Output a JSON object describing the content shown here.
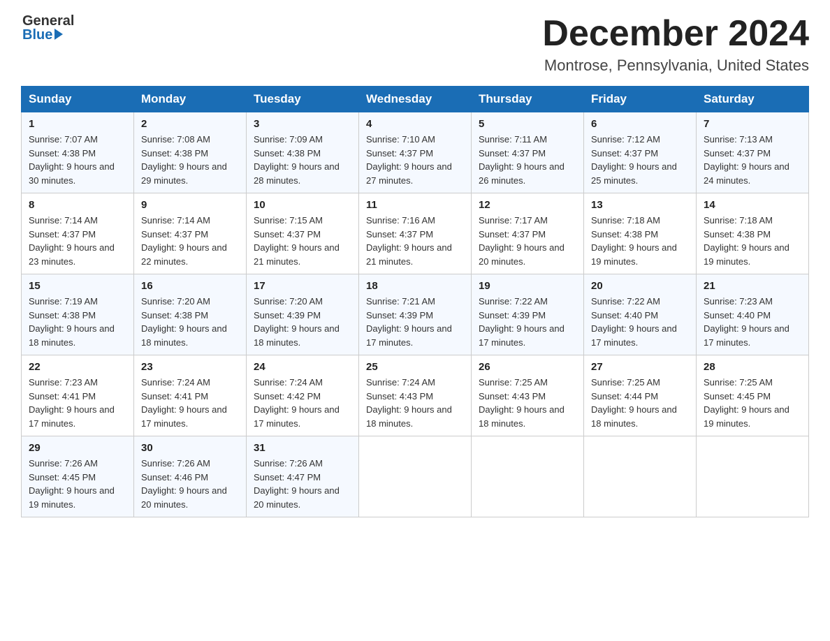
{
  "header": {
    "logo_general": "General",
    "logo_blue": "Blue",
    "month_title": "December 2024",
    "location": "Montrose, Pennsylvania, United States"
  },
  "days_of_week": [
    "Sunday",
    "Monday",
    "Tuesday",
    "Wednesday",
    "Thursday",
    "Friday",
    "Saturday"
  ],
  "weeks": [
    [
      {
        "day": "1",
        "sunrise": "7:07 AM",
        "sunset": "4:38 PM",
        "daylight": "9 hours and 30 minutes."
      },
      {
        "day": "2",
        "sunrise": "7:08 AM",
        "sunset": "4:38 PM",
        "daylight": "9 hours and 29 minutes."
      },
      {
        "day": "3",
        "sunrise": "7:09 AM",
        "sunset": "4:38 PM",
        "daylight": "9 hours and 28 minutes."
      },
      {
        "day": "4",
        "sunrise": "7:10 AM",
        "sunset": "4:37 PM",
        "daylight": "9 hours and 27 minutes."
      },
      {
        "day": "5",
        "sunrise": "7:11 AM",
        "sunset": "4:37 PM",
        "daylight": "9 hours and 26 minutes."
      },
      {
        "day": "6",
        "sunrise": "7:12 AM",
        "sunset": "4:37 PM",
        "daylight": "9 hours and 25 minutes."
      },
      {
        "day": "7",
        "sunrise": "7:13 AM",
        "sunset": "4:37 PM",
        "daylight": "9 hours and 24 minutes."
      }
    ],
    [
      {
        "day": "8",
        "sunrise": "7:14 AM",
        "sunset": "4:37 PM",
        "daylight": "9 hours and 23 minutes."
      },
      {
        "day": "9",
        "sunrise": "7:14 AM",
        "sunset": "4:37 PM",
        "daylight": "9 hours and 22 minutes."
      },
      {
        "day": "10",
        "sunrise": "7:15 AM",
        "sunset": "4:37 PM",
        "daylight": "9 hours and 21 minutes."
      },
      {
        "day": "11",
        "sunrise": "7:16 AM",
        "sunset": "4:37 PM",
        "daylight": "9 hours and 21 minutes."
      },
      {
        "day": "12",
        "sunrise": "7:17 AM",
        "sunset": "4:37 PM",
        "daylight": "9 hours and 20 minutes."
      },
      {
        "day": "13",
        "sunrise": "7:18 AM",
        "sunset": "4:38 PM",
        "daylight": "9 hours and 19 minutes."
      },
      {
        "day": "14",
        "sunrise": "7:18 AM",
        "sunset": "4:38 PM",
        "daylight": "9 hours and 19 minutes."
      }
    ],
    [
      {
        "day": "15",
        "sunrise": "7:19 AM",
        "sunset": "4:38 PM",
        "daylight": "9 hours and 18 minutes."
      },
      {
        "day": "16",
        "sunrise": "7:20 AM",
        "sunset": "4:38 PM",
        "daylight": "9 hours and 18 minutes."
      },
      {
        "day": "17",
        "sunrise": "7:20 AM",
        "sunset": "4:39 PM",
        "daylight": "9 hours and 18 minutes."
      },
      {
        "day": "18",
        "sunrise": "7:21 AM",
        "sunset": "4:39 PM",
        "daylight": "9 hours and 17 minutes."
      },
      {
        "day": "19",
        "sunrise": "7:22 AM",
        "sunset": "4:39 PM",
        "daylight": "9 hours and 17 minutes."
      },
      {
        "day": "20",
        "sunrise": "7:22 AM",
        "sunset": "4:40 PM",
        "daylight": "9 hours and 17 minutes."
      },
      {
        "day": "21",
        "sunrise": "7:23 AM",
        "sunset": "4:40 PM",
        "daylight": "9 hours and 17 minutes."
      }
    ],
    [
      {
        "day": "22",
        "sunrise": "7:23 AM",
        "sunset": "4:41 PM",
        "daylight": "9 hours and 17 minutes."
      },
      {
        "day": "23",
        "sunrise": "7:24 AM",
        "sunset": "4:41 PM",
        "daylight": "9 hours and 17 minutes."
      },
      {
        "day": "24",
        "sunrise": "7:24 AM",
        "sunset": "4:42 PM",
        "daylight": "9 hours and 17 minutes."
      },
      {
        "day": "25",
        "sunrise": "7:24 AM",
        "sunset": "4:43 PM",
        "daylight": "9 hours and 18 minutes."
      },
      {
        "day": "26",
        "sunrise": "7:25 AM",
        "sunset": "4:43 PM",
        "daylight": "9 hours and 18 minutes."
      },
      {
        "day": "27",
        "sunrise": "7:25 AM",
        "sunset": "4:44 PM",
        "daylight": "9 hours and 18 minutes."
      },
      {
        "day": "28",
        "sunrise": "7:25 AM",
        "sunset": "4:45 PM",
        "daylight": "9 hours and 19 minutes."
      }
    ],
    [
      {
        "day": "29",
        "sunrise": "7:26 AM",
        "sunset": "4:45 PM",
        "daylight": "9 hours and 19 minutes."
      },
      {
        "day": "30",
        "sunrise": "7:26 AM",
        "sunset": "4:46 PM",
        "daylight": "9 hours and 20 minutes."
      },
      {
        "day": "31",
        "sunrise": "7:26 AM",
        "sunset": "4:47 PM",
        "daylight": "9 hours and 20 minutes."
      },
      null,
      null,
      null,
      null
    ]
  ]
}
